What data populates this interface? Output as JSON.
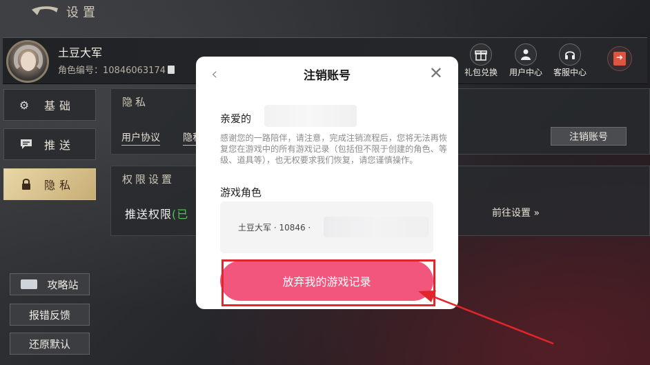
{
  "header": {
    "title": "设置"
  },
  "profile": {
    "name": "土豆大军",
    "id_label": "角色编号：",
    "id_value": "10846063174"
  },
  "top_actions": [
    {
      "label": "礼包兑换",
      "icon": "gift-icon"
    },
    {
      "label": "用户中心",
      "icon": "user-center-icon"
    },
    {
      "label": "客服中心",
      "icon": "headset-icon"
    }
  ],
  "exit": {
    "icon": "exit-door-icon",
    "color": "#e0533f"
  },
  "tabs": [
    {
      "label": "基础",
      "icon": "gear-icon"
    },
    {
      "label": "推送",
      "icon": "message-icon"
    },
    {
      "label": "隐私",
      "icon": "lock-icon",
      "active": true
    }
  ],
  "privacy_panel": {
    "title": "隐私",
    "user_agreement": "用户协议",
    "privacy_link_partial": "隐私",
    "cancel_account": "注销账号"
  },
  "permission_panel": {
    "title": "权限设置",
    "push_label": "推送权限",
    "push_status_partial": "(已",
    "goto_settings": "前往设置 »"
  },
  "bottom_buttons": {
    "guide": "攻略站",
    "report": "报错反馈",
    "reset": "还原默认"
  },
  "modal": {
    "title": "注销账号",
    "greeting": "亲爱的",
    "notice": "感谢您的一路陪伴，请注意，完成注销流程后，您将无法再恢复您在游戏中的所有游戏记录（包括但不限于创建的角色、等级、道具等），也无权要求我们恢复，请您谨慎操作。",
    "role_section_title": "游戏角色",
    "role_entry": "土豆大军 · 10846 ·",
    "abandon_button": "放弃我的游戏记录",
    "accent_color": "#f2567d"
  },
  "annotation": {
    "color": "#e0262a"
  }
}
